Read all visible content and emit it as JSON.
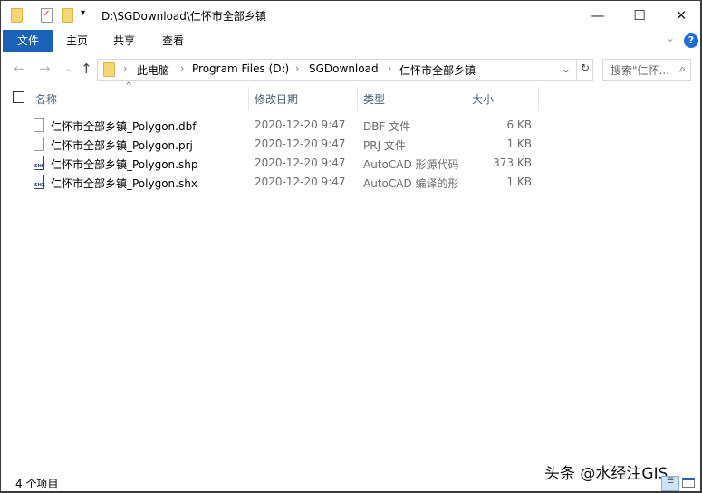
{
  "window": {
    "title": "D:\\SGDownload\\仁怀市全部乡镇",
    "minimize": "—",
    "maximize": "☐",
    "close": "✕"
  },
  "ribbon": {
    "tabs": [
      "文件",
      "主页",
      "共享",
      "查看"
    ],
    "help": "?",
    "expand": "⌄"
  },
  "nav": {
    "back": "←",
    "forward": "→",
    "recent": "⌄",
    "up": "↑",
    "breadcrumbs": [
      "此电脑",
      "Program Files (D:)",
      "SGDownload",
      "仁怀市全部乡镇"
    ],
    "refresh": "↻",
    "dropdown": "⌄",
    "search_placeholder": "搜索\"仁怀...",
    "search_icon": "⌕"
  },
  "columns": {
    "name": "名称",
    "modified": "修改日期",
    "type": "类型",
    "size": "大小"
  },
  "files": [
    {
      "name": "仁怀市全部乡镇_Polygon.dbf",
      "modified": "2020-12-20 9:47",
      "type": "DBF 文件",
      "size": "6 KB",
      "icon": "file-icon"
    },
    {
      "name": "仁怀市全部乡镇_Polygon.prj",
      "modified": "2020-12-20 9:47",
      "type": "PRJ 文件",
      "size": "1 KB",
      "icon": "file-icon"
    },
    {
      "name": "仁怀市全部乡镇_Polygon.shp",
      "modified": "2020-12-20 9:47",
      "type": "AutoCAD 形源代码",
      "size": "373 KB",
      "icon": "SHP"
    },
    {
      "name": "仁怀市全部乡镇_Polygon.shx",
      "modified": "2020-12-20 9:47",
      "type": "AutoCAD 编译的形",
      "size": "1 KB",
      "icon": "SHX"
    }
  ],
  "status": "4 个项目",
  "watermark": "头条 @水经注GIS"
}
